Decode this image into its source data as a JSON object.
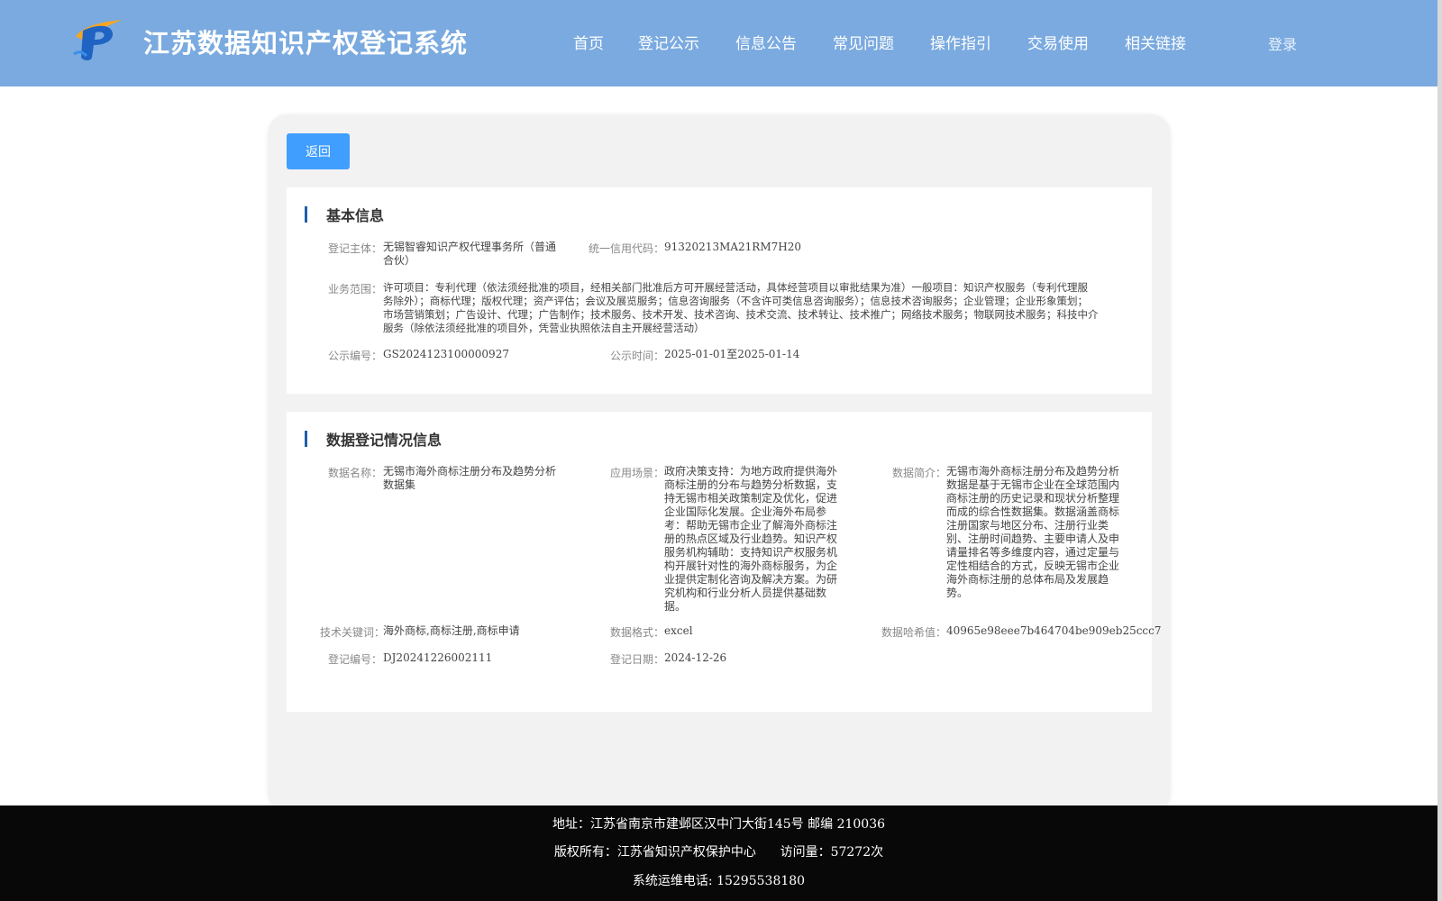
{
  "header": {
    "title": "江苏数据知识产权登记系统",
    "nav": [
      "首页",
      "登记公示",
      "信息公告",
      "常见问题",
      "操作指引",
      "交易使用",
      "相关链接"
    ],
    "login": "登录"
  },
  "back_label": "返回",
  "basic": {
    "title": "基本信息",
    "subject_label": "登记主体：",
    "subject_value": "无锡智睿知识产权代理事务所（普通\n合伙）",
    "credit_label": "统一信用代码：",
    "credit_value": "91320213MA21RM7H20",
    "scope_label": "业务范围：",
    "scope_value": "许可项目：专利代理（依法须经批准的项目，经相关部门批准后方可开展经营活动，具体经营项目以审批结果为准）一般项目：知识产权服务（专利代理服\n务除外）；商标代理；版权代理；资产评估；会议及展览服务；信息咨询服务（不含许可类信息咨询服务）；信息技术咨询服务；企业管理；企业形象策划；\n市场营销策划；广告设计、代理；广告制作；技术服务、技术开发、技术咨询、技术交流、技术转让、技术推广；网络技术服务；物联网技术服务；科技中介\n服务（除依法须经批准的项目外，凭营业执照依法自主开展经营活动）",
    "pub_no_label": "公示编号：",
    "pub_no_value": "GS2024123100000927",
    "pub_time_label": "公示时间：",
    "pub_time_value": "2025-01-01至2025-01-14"
  },
  "data_info": {
    "title": "数据登记情况信息",
    "name_label": "数据名称：",
    "name_value": "无锡市海外商标注册分布及趋势分析\n数据集",
    "scene_label": "应用场景：",
    "scene_value": "政府决策支持：为地方政府提供海外\n商标注册的分布与趋势分析数据，支\n持无锡市相关政策制定及优化，促进\n企业国际化发展。企业海外布局参\n考：帮助无锡市企业了解海外商标注\n册的热点区域及行业趋势。知识产权\n服务机构辅助：支持知识产权服务机\n构开展针对性的海外商标服务，为企\n业提供定制化咨询及解决方案。为研\n究机构和行业分析人员提供基础数\n据。",
    "intro_label": "数据简介：",
    "intro_value": "无锡市海外商标注册分布及趋势分析\n数据是基于无锡市企业在全球范围内\n商标注册的历史记录和现状分析整理\n而成的综合性数据集。数据涵盖商标\n注册国家与地区分布、注册行业类\n别、注册时间趋势、主要申请人及申\n请量排名等多维度内容，通过定量与\n定性相结合的方式，反映无锡市企业\n海外商标注册的总体布局及发展趋\n势。",
    "keywords_label": "技术关键词：",
    "keywords_value": "海外商标,商标注册,商标申请",
    "format_label": "数据格式：",
    "format_value": "excel",
    "hash_label": "数据哈希值：",
    "hash_value": "40965e98eee7b464704be909eb25ccc7",
    "reg_no_label": "登记编号：",
    "reg_no_value": "DJ20241226002111",
    "reg_date_label": "登记日期：",
    "reg_date_value": "2024-12-26"
  },
  "footer": {
    "address": "地址：江苏省南京市建邺区汉中门大街145号 邮编 210036",
    "copyright": "版权所有：江苏省知识产权保护中心      访问量：57272次",
    "phone": "系统运维电话: 15295538180"
  },
  "colors": {
    "header_bg": "#7aaadf",
    "button_blue": "#409eff",
    "section_bar": "#1f5fa8",
    "footer_bg": "#080808"
  }
}
